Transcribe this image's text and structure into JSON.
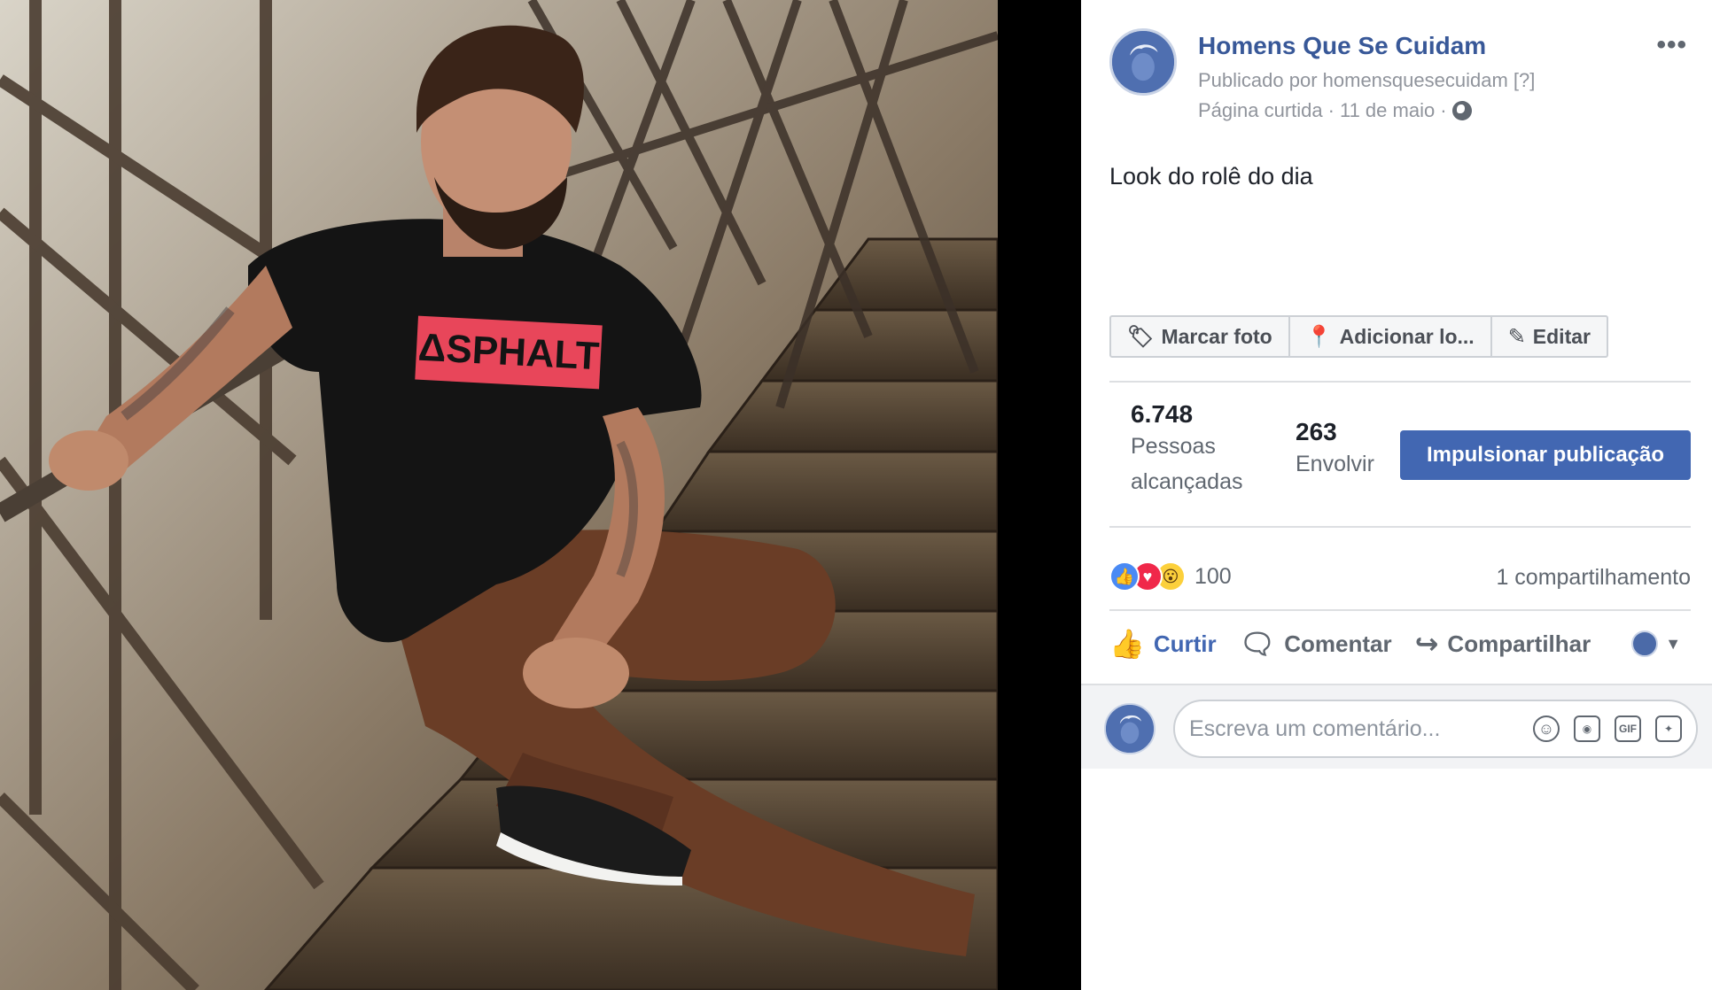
{
  "photo": {
    "shirt_text": "ΔSPHALT"
  },
  "post": {
    "page_name": "Homens Que Se Cuidam",
    "published_by": "Publicado por homensquesecuidam",
    "help_tag": "[?]",
    "liked_label": "Página curtida",
    "separator": "·",
    "date": "11 de maio",
    "more_menu": "•••",
    "text": "Look do rolê do dia"
  },
  "photo_tools": {
    "tag_label": "Marcar foto",
    "location_label": "Adicionar lo...",
    "edit_label": "Editar"
  },
  "stats": {
    "reached_value": "6.748",
    "reached_label_line1": "Pessoas",
    "reached_label_line2": "alcançadas",
    "engagement_value": "263",
    "engagement_label": "Envolvir",
    "boost_label": "Impulsionar publicação"
  },
  "reactions": {
    "count": "100",
    "shares": "1 compartilhamento",
    "types": [
      "like",
      "love",
      "wow"
    ]
  },
  "actions": {
    "like": "Curtir",
    "comment": "Comentar",
    "share": "Compartilhar"
  },
  "comment": {
    "placeholder": "Escreva um comentário...",
    "gif_label": "GIF"
  },
  "colors": {
    "brand_link": "#385898",
    "boost_button": "#4267b2",
    "active_action": "#4267b2"
  }
}
